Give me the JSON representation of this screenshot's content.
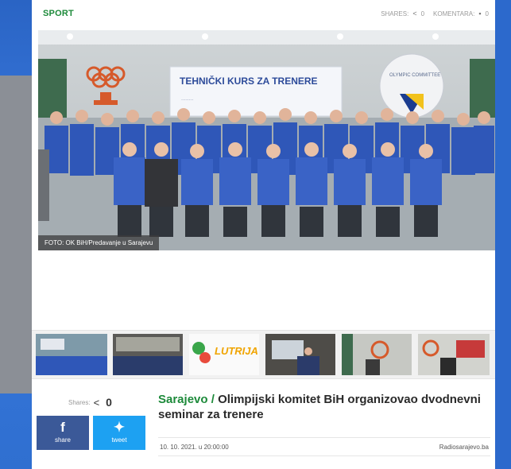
{
  "section": "SPORT",
  "meta": {
    "shares_label": "SHARES:",
    "shares_count": "0",
    "comments_label": "KOMENTARA:",
    "comments_count": "0"
  },
  "hero": {
    "caption": "FOTO: OK BiH/Predavanje u Sarajevu",
    "banner_text": "TEHNIČKI KURS ZA TRENERE",
    "committee_text": "OLYMPIC COMMITTEE"
  },
  "thumbnails": [
    {
      "name": "group-photo"
    },
    {
      "name": "lecture-room"
    },
    {
      "name": "lutrija-ad",
      "text": "LUTRIJA"
    },
    {
      "name": "speaker-podium"
    },
    {
      "name": "olympic-wall"
    },
    {
      "name": "presentation"
    }
  ],
  "share": {
    "label": "Shares:",
    "count": "0",
    "facebook_label": "share",
    "twitter_label": "tweet"
  },
  "article": {
    "location": "Sarajevo /",
    "title": "Olimpijski komitet BiH organizovao dvodnevni seminar za trenere",
    "date": "10. 10. 2021. u 20:00:00",
    "source": "Radiosarajevo.ba"
  },
  "colors": {
    "section_green": "#1d8a3a",
    "facebook": "#3b5998",
    "twitter": "#1da1f2",
    "background_blue": "#2f6fd0"
  }
}
